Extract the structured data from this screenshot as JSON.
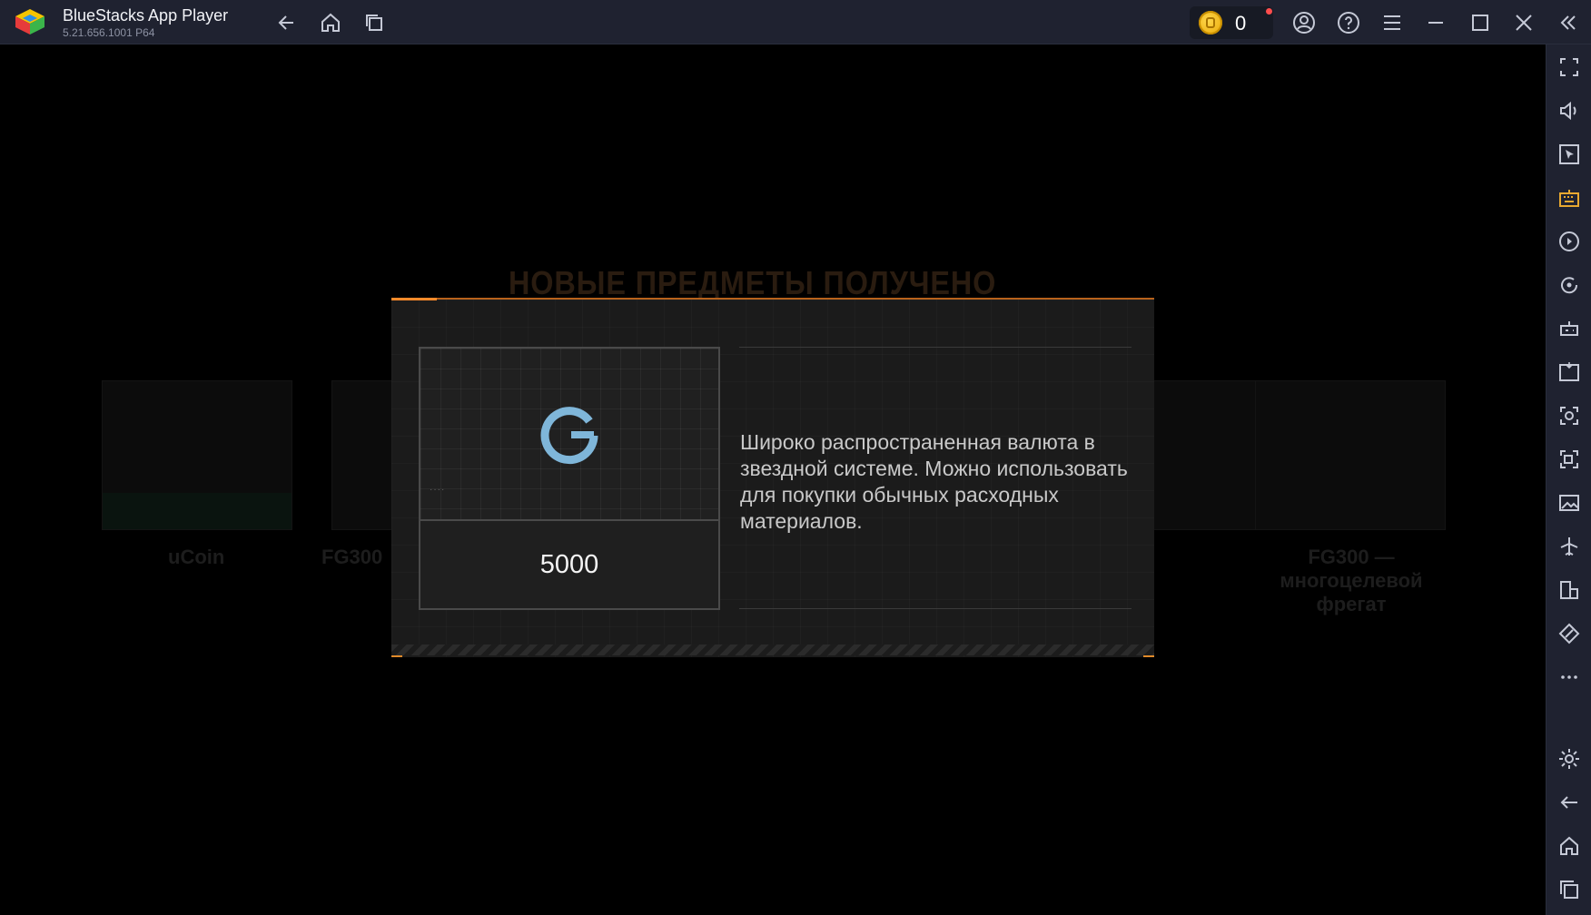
{
  "window": {
    "title": "BlueStacks App Player",
    "version": "5.21.656.1001 P64"
  },
  "titlebar": {
    "coin_count": "0",
    "icons": [
      "back-icon",
      "home-icon",
      "recent-apps-icon",
      "account-icon",
      "help-icon",
      "menu-icon",
      "minimize-icon",
      "maximize-icon",
      "close-icon",
      "collapse-sidebar-icon"
    ]
  },
  "sidebar": {
    "icons": [
      "fullscreen-icon",
      "volume-icon",
      "pointer-icon",
      "keyboard-icon",
      "macro-icon",
      "rotate-icon",
      "gamepad-icon",
      "apk-icon",
      "screenshot-icon",
      "record-icon",
      "media-icon",
      "airplane-icon",
      "multi-instance-icon",
      "eco-mode-icon",
      "more-icon",
      "settings-icon",
      "android-back-icon",
      "android-home-icon",
      "android-recents-icon"
    ]
  },
  "game": {
    "background_heading": "НОВЫЕ ПРЕДМЕТЫ ПОЛУЧЕНО",
    "background_labels": [
      "uCoin",
      "FG300",
      "FG300 — многоцелевой фрегат"
    ],
    "dialog": {
      "item_amount": "5000",
      "item_description": "Широко распространенная валюта в звездной системе. Можно использовать для покупки обычных расходных материалов."
    }
  },
  "colors": {
    "titlebar_bg": "#1f2230",
    "accent_orange": "#b8621c",
    "currency_blue": "#7fb6d9"
  }
}
